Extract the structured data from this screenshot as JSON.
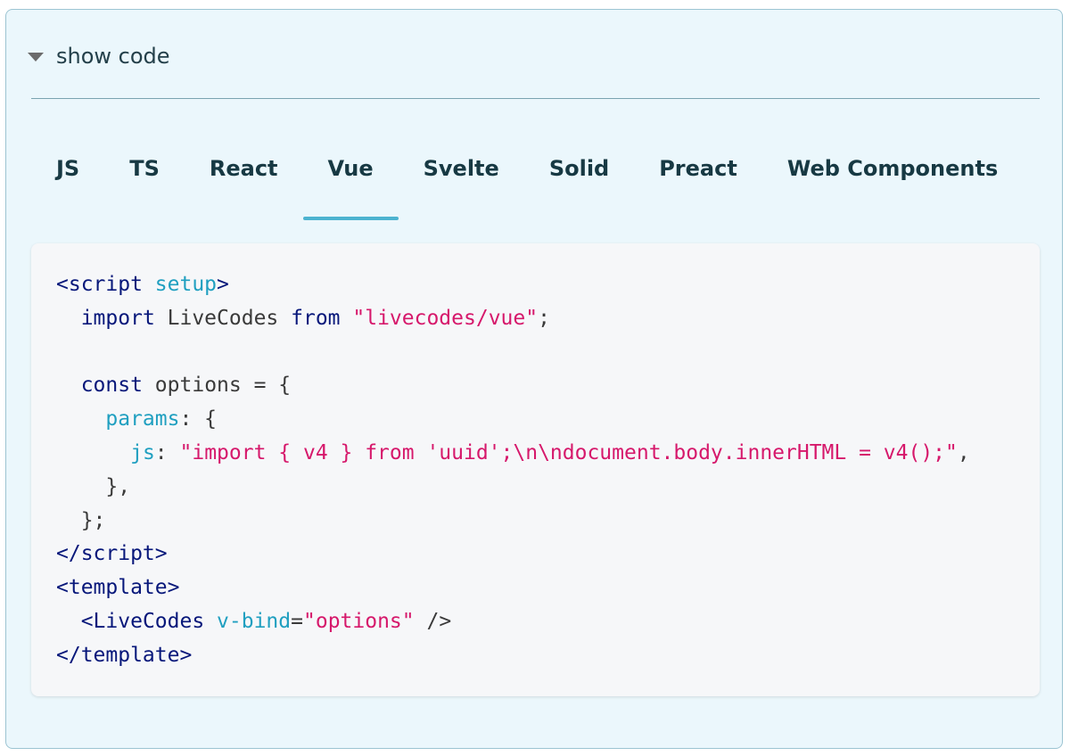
{
  "colors": {
    "panel_bg": "#ebf7fc",
    "panel_border": "#9cc4d2",
    "active_tab_underline": "#4cb3d0",
    "code_bg": "#f6f7f9",
    "token_tag": "#07177a",
    "token_attr": "#1f9fc0",
    "token_string": "#d6186b"
  },
  "disclosure": {
    "icon": "caret-down-icon",
    "label": "show code"
  },
  "tabs": [
    {
      "label": "JS",
      "active": false
    },
    {
      "label": "TS",
      "active": false
    },
    {
      "label": "React",
      "active": false
    },
    {
      "label": "Vue",
      "active": true
    },
    {
      "label": "Svelte",
      "active": false
    },
    {
      "label": "Solid",
      "active": false
    },
    {
      "label": "Preact",
      "active": false
    },
    {
      "label": "Web Components",
      "active": false
    }
  ],
  "code": {
    "language": "vue",
    "lines": [
      [
        [
          "tag",
          "<script"
        ],
        [
          "plain",
          " "
        ],
        [
          "attr",
          "setup"
        ],
        [
          "tag",
          ">"
        ]
      ],
      [
        [
          "plain",
          "  "
        ],
        [
          "kw",
          "import"
        ],
        [
          "plain",
          " LiveCodes "
        ],
        [
          "kw",
          "from"
        ],
        [
          "plain",
          " "
        ],
        [
          "str",
          "\"livecodes/vue\""
        ],
        [
          "plain",
          ";"
        ]
      ],
      [],
      [
        [
          "plain",
          "  "
        ],
        [
          "kw",
          "const"
        ],
        [
          "plain",
          " options = {"
        ]
      ],
      [
        [
          "plain",
          "    "
        ],
        [
          "attr",
          "params"
        ],
        [
          "plain",
          ": {"
        ]
      ],
      [
        [
          "plain",
          "      "
        ],
        [
          "attr",
          "js"
        ],
        [
          "plain",
          ": "
        ],
        [
          "str",
          "\"import { v4 } from 'uuid';\\n\\ndocument.body.innerHTML = v4();\""
        ],
        [
          "plain",
          ","
        ]
      ],
      [
        [
          "plain",
          "    },"
        ]
      ],
      [
        [
          "plain",
          "  };"
        ]
      ],
      [
        [
          "tag",
          "</script"
        ],
        [
          "tag",
          ">"
        ]
      ],
      [
        [
          "tag",
          "<template"
        ],
        [
          "tag",
          ">"
        ]
      ],
      [
        [
          "plain",
          "  "
        ],
        [
          "tag",
          "<LiveCodes"
        ],
        [
          "plain",
          " "
        ],
        [
          "attr",
          "v-bind"
        ],
        [
          "plain",
          "="
        ],
        [
          "str",
          "\"options\""
        ],
        [
          "plain",
          " />"
        ]
      ],
      [
        [
          "tag",
          "</template"
        ],
        [
          "tag",
          ">"
        ]
      ]
    ]
  }
}
